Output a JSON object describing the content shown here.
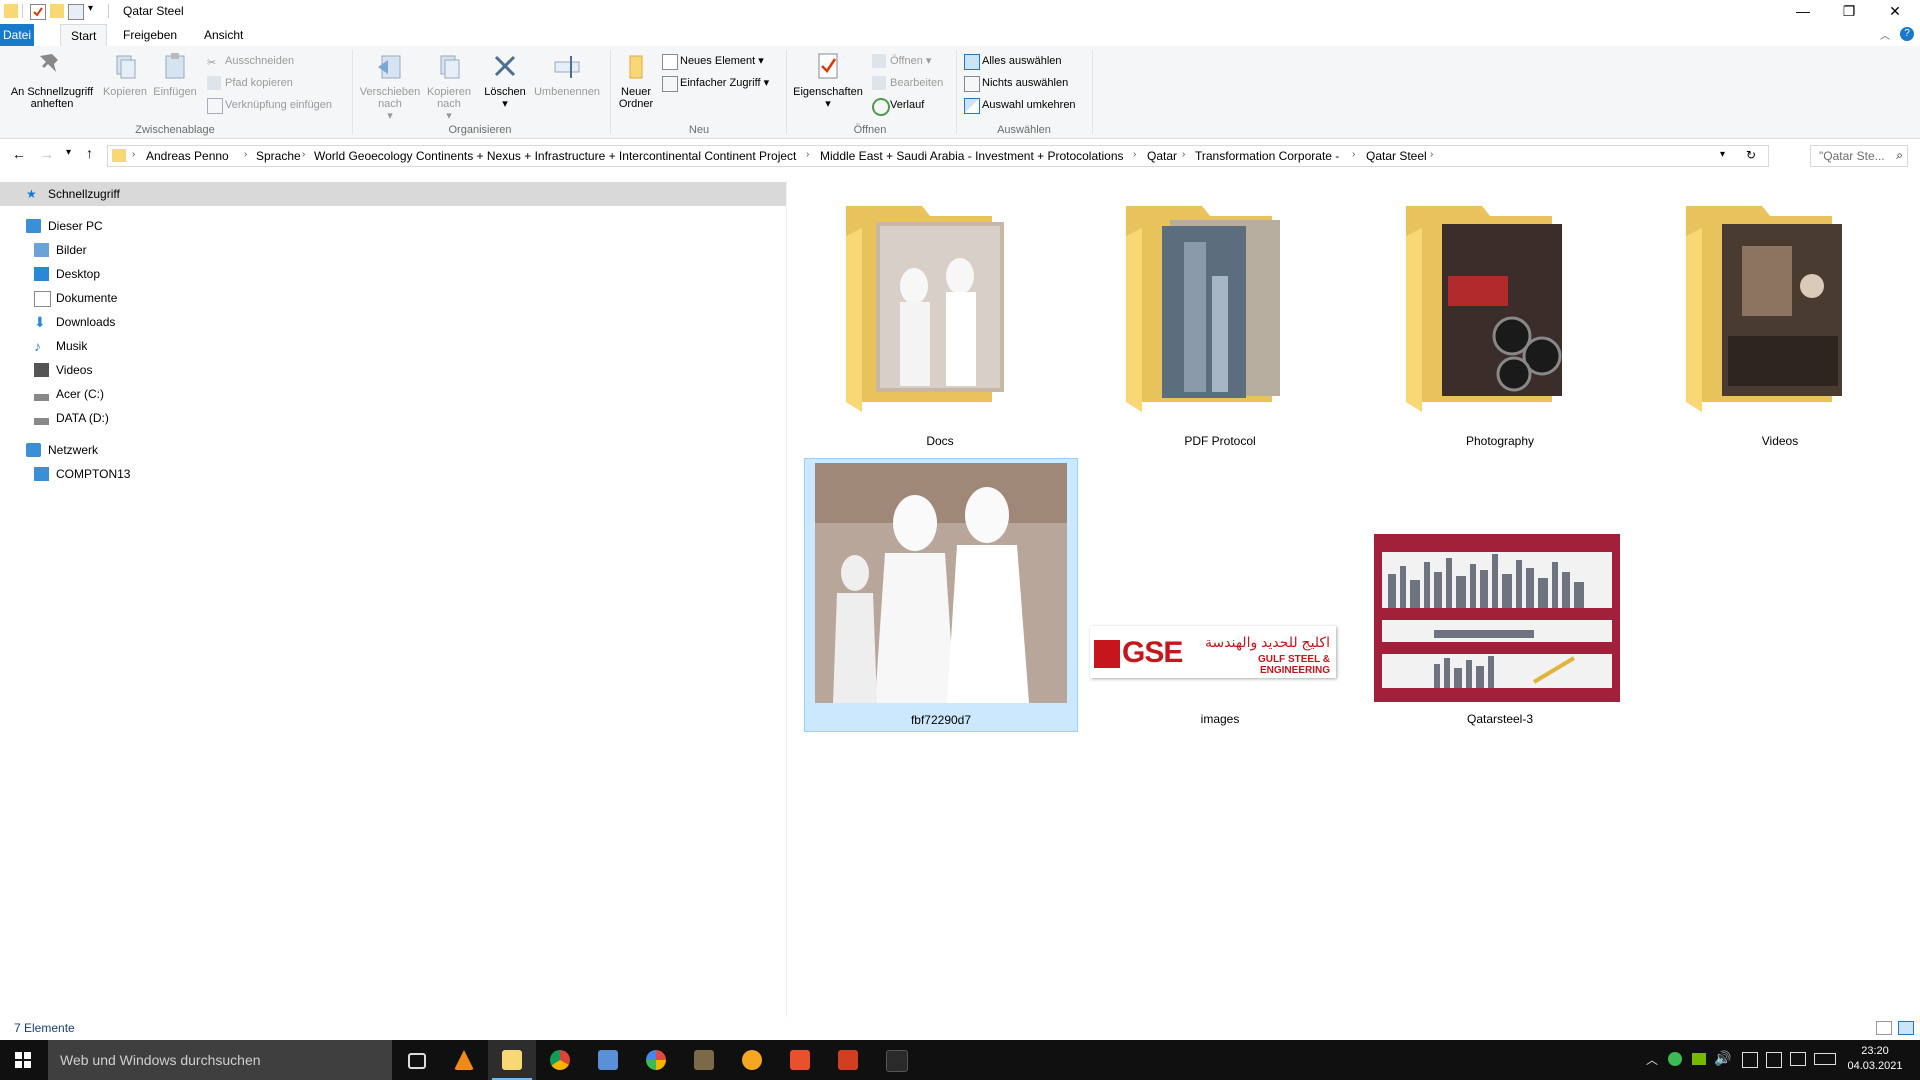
{
  "window": {
    "title": "Qatar Steel",
    "minimize": "—",
    "maximize": "❐",
    "close": "✕"
  },
  "tabs": [
    {
      "label": "Datei"
    },
    {
      "label": "Start"
    },
    {
      "label": "Freigeben"
    },
    {
      "label": "Ansicht"
    }
  ],
  "ribbon": {
    "groups": {
      "clipboard": "Zwischenablage",
      "organize": "Organisieren",
      "new": "Neu",
      "open": "Öffnen",
      "select": "Auswählen"
    },
    "pin": "An Schnellzugriff anheften",
    "copy": "Kopieren",
    "paste": "Einfügen",
    "cut": "Ausschneiden",
    "copy_path": "Pfad kopieren",
    "paste_shortcut": "Verknüpfung einfügen",
    "move_to": "Verschieben nach",
    "copy_to": "Kopieren nach",
    "delete": "Löschen",
    "rename": "Umbenennen",
    "new_folder": "Neuer Ordner",
    "new_item": "Neues Element",
    "easy_access": "Einfacher Zugriff",
    "properties": "Eigenschaften",
    "open": "Öffnen",
    "edit": "Bearbeiten",
    "history": "Verlauf",
    "select_all": "Alles auswählen",
    "select_none": "Nichts auswählen",
    "invert_selection": "Auswahl umkehren"
  },
  "address": {
    "crumbs": [
      "Andreas Penno",
      "Sprache",
      "World Geoecology Continents + Nexus + Infrastructure + Intercontinental Continent Project",
      "Middle East + Saudi Arabia - Investment + Protocolations",
      "Qatar",
      "Transformation Corporate -",
      "Qatar Steel"
    ],
    "search_placeholder": "\"Qatar Ste..."
  },
  "nav": {
    "quick_access": "Schnellzugriff",
    "this_pc": "Dieser PC",
    "items": [
      "Bilder",
      "Desktop",
      "Dokumente",
      "Downloads",
      "Musik",
      "Videos",
      "Acer (C:)",
      "DATA (D:)"
    ],
    "network": "Netzwerk",
    "network_items": [
      "COMPTON13"
    ]
  },
  "files": [
    {
      "name": "Docs",
      "type": "folder"
    },
    {
      "name": "PDF Protocol",
      "type": "folder"
    },
    {
      "name": "Photography",
      "type": "folder"
    },
    {
      "name": "Videos",
      "type": "folder"
    },
    {
      "name": "fbf72290d7",
      "type": "image",
      "selected": true
    },
    {
      "name": "images",
      "type": "image"
    },
    {
      "name": "Qatarsteel-3",
      "type": "image"
    }
  ],
  "thumbs": {
    "gse_text": "GSE",
    "gse_arabic": "اكليج للحديد والهندسة",
    "gse_english": "GULF STEEL & ENGINEERING"
  },
  "status": {
    "count": "7 Elemente"
  },
  "taskbar": {
    "search_placeholder": "Web und Windows durchsuchen",
    "time": "23:20",
    "date": "04.03.2021"
  },
  "colors": {
    "accent": "#1979ca",
    "selection": "#cce8ff",
    "folder": "#f8d775"
  }
}
